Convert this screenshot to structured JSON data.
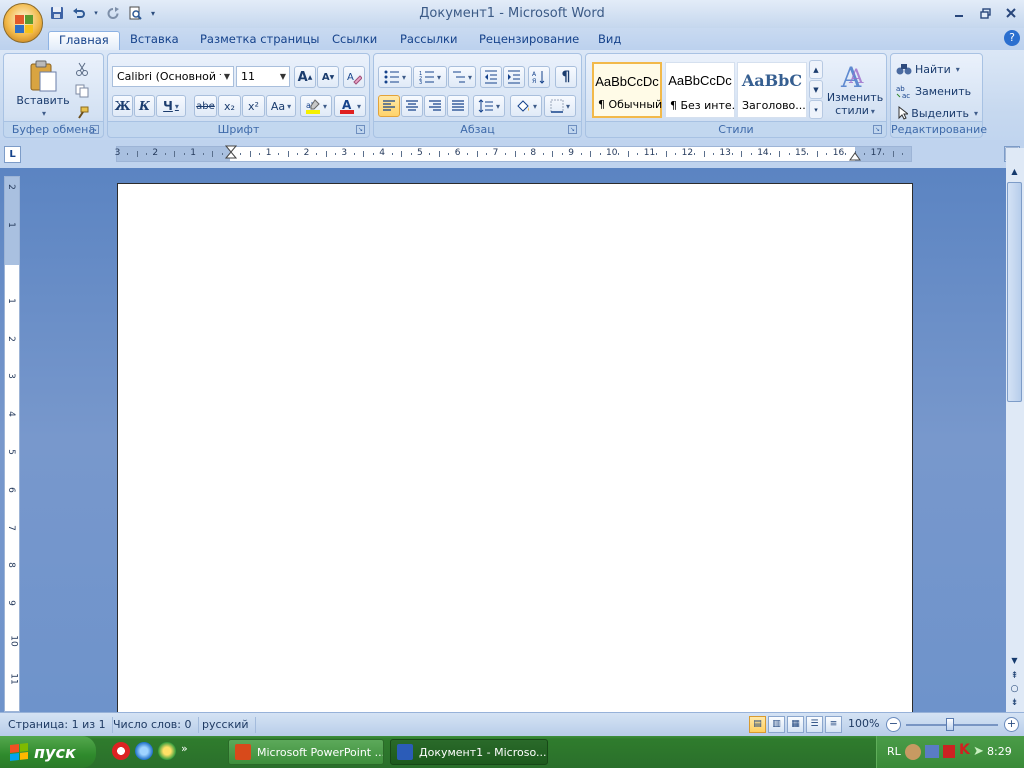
{
  "window": {
    "title": "Документ1 - Microsoft Word"
  },
  "quick_access": [
    {
      "name": "save-icon",
      "glyph": "💾"
    },
    {
      "name": "undo-icon",
      "glyph": "↶"
    },
    {
      "name": "redo-icon",
      "glyph": "↻"
    },
    {
      "name": "print-preview-icon",
      "glyph": "🗎"
    },
    {
      "name": "customize-icon",
      "glyph": "▾"
    }
  ],
  "tabs": [
    "Главная",
    "Вставка",
    "Разметка страницы",
    "Ссылки",
    "Рассылки",
    "Рецензирование",
    "Вид"
  ],
  "ribbon": {
    "clipboard": {
      "title": "Буфер обмена",
      "paste_label": "Вставить"
    },
    "font": {
      "title": "Шрифт",
      "font_name": "Calibri (Основной те",
      "font_size": "11",
      "bold": "Ж",
      "italic": "К",
      "underline": "Ч",
      "strike": "abe",
      "subscript": "x₂",
      "superscript": "x²",
      "case": "Aa",
      "grow": "A",
      "shrink": "A",
      "clear": "A"
    },
    "paragraph": {
      "title": "Абзац",
      "pilcrow": "¶"
    },
    "styles": {
      "title": "Стили",
      "items": [
        {
          "sample": "AaBbCcDc",
          "name": "¶ Обычный"
        },
        {
          "sample": "AaBbCcDc",
          "name": "¶ Без инте..."
        },
        {
          "sample": "AaBbC",
          "name": "Заголово..."
        }
      ],
      "change_label_1": "Изменить",
      "change_label_2": "стили"
    },
    "editing": {
      "title": "Редактирование",
      "find": "Найти",
      "replace": "Заменить",
      "select": "Выделить"
    }
  },
  "ruler": {
    "h_labels": [
      "3",
      "2",
      "1",
      "1",
      "2",
      "3",
      "4",
      "5",
      "6",
      "7",
      "8",
      "9",
      "10",
      "11",
      "12",
      "13",
      "14",
      "15",
      "16",
      "17"
    ],
    "v_labels": [
      "2",
      "1",
      "1",
      "2",
      "3",
      "4",
      "5",
      "6",
      "7",
      "8",
      "9",
      "10",
      "11"
    ]
  },
  "statusbar": {
    "page": "Страница: 1 из 1",
    "words": "Число слов: 0",
    "language": "русский",
    "zoom": "100%"
  },
  "taskbar": {
    "start_label": "пуск",
    "tasks": [
      {
        "label": "Microsoft PowerPoint ...",
        "active": false
      },
      {
        "label": "Документ1 - Microso...",
        "active": true
      }
    ],
    "lang": "RL",
    "clock": "8:29"
  },
  "colors": {
    "ribbon_text": "#15428b",
    "workspace": "#6e93cb",
    "taskbar": "#2f7c2d",
    "style_selected": "#f2b94a"
  }
}
